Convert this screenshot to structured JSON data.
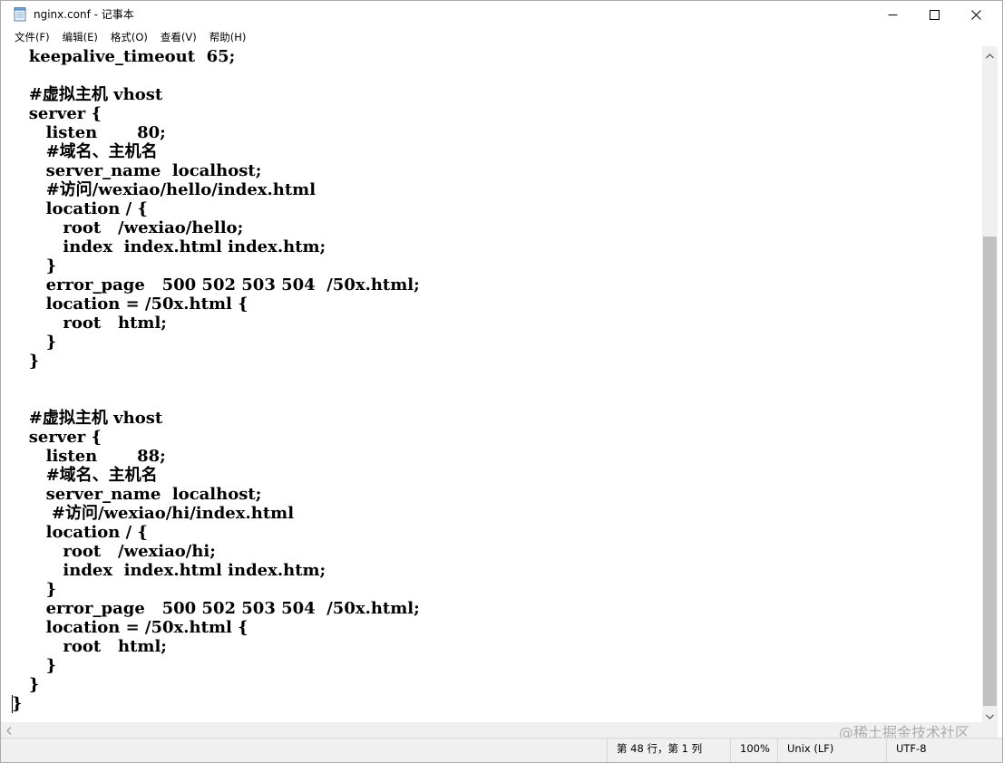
{
  "window": {
    "title": "nginx.conf - 记事本"
  },
  "menu": {
    "items": [
      {
        "label": "文件(F)"
      },
      {
        "label": "编辑(E)"
      },
      {
        "label": "格式(O)"
      },
      {
        "label": "查看(V)"
      },
      {
        "label": "帮助(H)"
      }
    ]
  },
  "editor": {
    "lines": [
      "   keepalive_timeout  65;",
      "",
      "   #虚拟主机 vhost",
      "   server {",
      "      listen       80;",
      "      #域名、主机名",
      "      server_name  localhost;",
      "      #访问/wexiao/hello/index.html",
      "      location / {",
      "         root   /wexiao/hello;",
      "         index  index.html index.htm;",
      "      }",
      "      error_page   500 502 503 504  /50x.html;",
      "      location = /50x.html {",
      "         root   html;",
      "      }",
      "   }",
      "",
      "",
      "   #虚拟主机 vhost",
      "   server {",
      "      listen       88;",
      "      #域名、主机名",
      "      server_name  localhost;",
      "       #访问/wexiao/hi/index.html",
      "      location / {",
      "         root   /wexiao/hi;",
      "         index  index.html index.htm;",
      "      }",
      "      error_page   500 502 503 504  /50x.html;",
      "      location = /50x.html {",
      "         root   html;",
      "      }",
      "   }",
      "}",
      ""
    ]
  },
  "statusbar": {
    "position": "第 48 行，第 1 列",
    "zoom": "100%",
    "line_ending": "Unix (LF)",
    "encoding": "UTF-8"
  },
  "watermark": {
    "text": "@稀土掘金技术社区"
  }
}
